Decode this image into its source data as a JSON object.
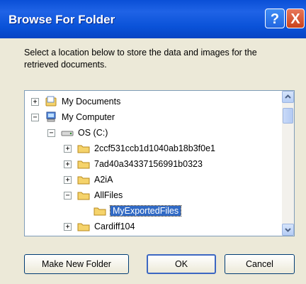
{
  "window": {
    "title": "Browse For Folder",
    "help_label": "?",
    "close_label": "X"
  },
  "prompt": "Select a location below to store the data and images for the retrieved documents.",
  "tree": [
    {
      "label": "My Documents",
      "expander": "+",
      "icon": "my-documents-icon",
      "level": 0
    },
    {
      "label": "My Computer",
      "expander": "−",
      "icon": "my-computer-icon",
      "level": 0
    },
    {
      "label": "OS (C:)",
      "expander": "−",
      "icon": "drive-icon",
      "level": 1
    },
    {
      "label": "2ccf531ccb1d1040ab18b3f0e1",
      "expander": "+",
      "icon": "folder-icon",
      "level": 2
    },
    {
      "label": "7ad40a34337156991b0323",
      "expander": "+",
      "icon": "folder-icon",
      "level": 2
    },
    {
      "label": "A2iA",
      "expander": "+",
      "icon": "folder-icon",
      "level": 2
    },
    {
      "label": "AllFiles",
      "expander": "−",
      "icon": "folder-icon",
      "level": 2
    },
    {
      "label": "MyExportedFiles",
      "expander": "",
      "icon": "folder-icon",
      "level": 3,
      "selected": true
    },
    {
      "label": "Cardiff104",
      "expander": "+",
      "icon": "folder-icon",
      "level": 2
    }
  ],
  "buttons": {
    "new_folder": "Make New Folder",
    "ok": "OK",
    "cancel": "Cancel"
  },
  "colors": {
    "titlebar": "#0a52d8",
    "selection": "#316ac5",
    "folder": "#f5d36b"
  }
}
